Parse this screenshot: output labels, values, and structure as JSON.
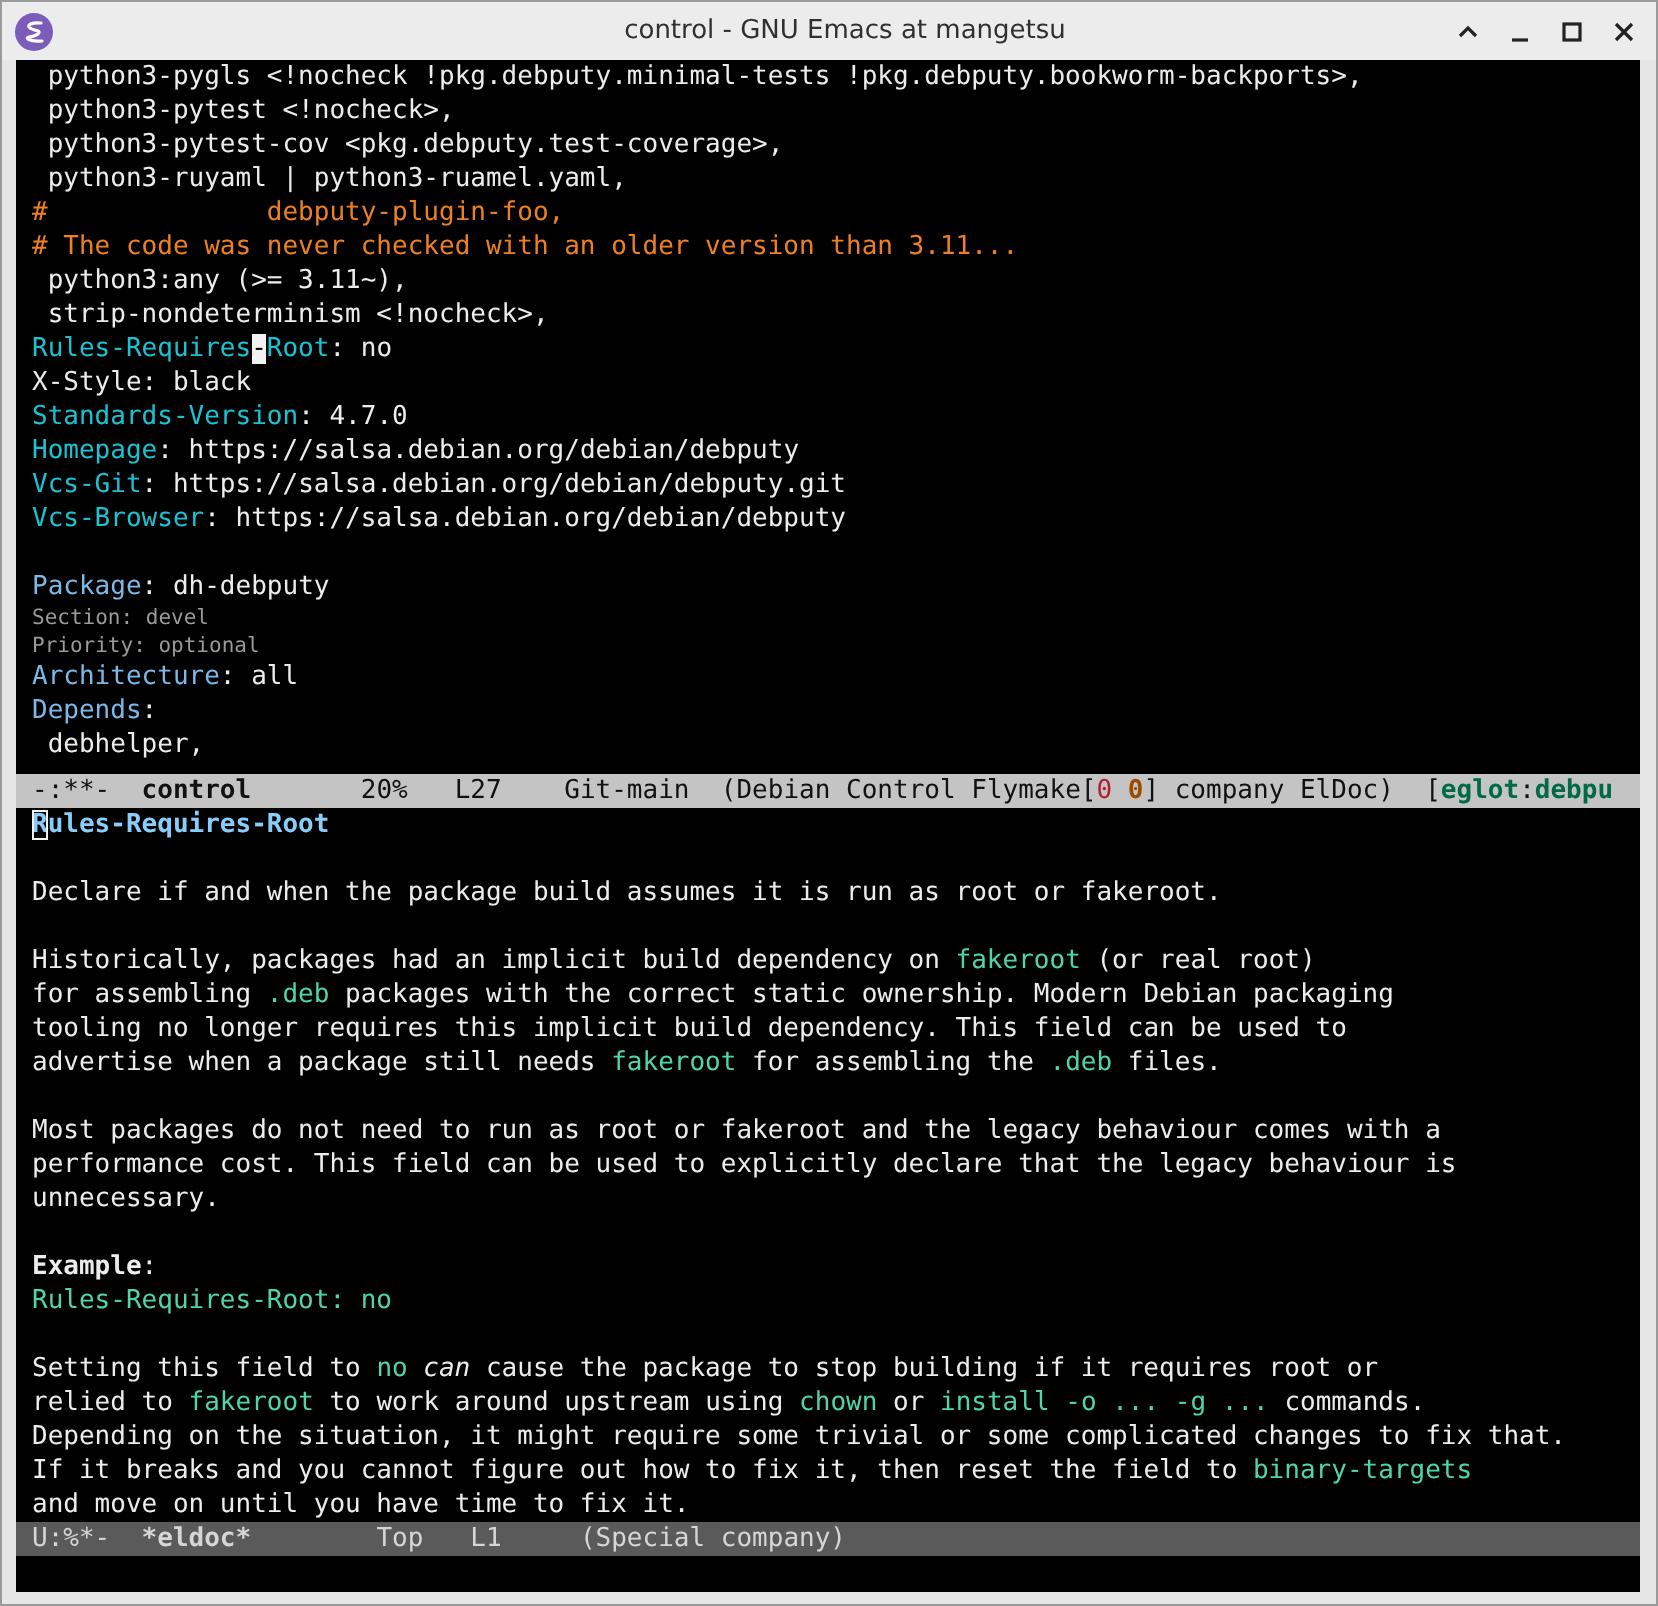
{
  "window": {
    "title": "control - GNU Emacs at mangetsu"
  },
  "top_pane": {
    "blocks": [
      {
        "lines": [
          {
            "segments": [
              {
                "kind": "plain",
                "text": " python3-pygls <!nocheck !pkg.debputy.minimal-tests !pkg.debputy.bookworm-backports>,"
              }
            ]
          },
          {
            "segments": [
              {
                "kind": "plain",
                "text": " python3-pytest <!nocheck>,"
              }
            ]
          },
          {
            "segments": [
              {
                "kind": "plain",
                "text": " python3-pytest-cov <pkg.debputy.test-coverage>,"
              }
            ]
          },
          {
            "segments": [
              {
                "kind": "plain",
                "text": " python3-ruyaml | python3-ruamel.yaml,"
              }
            ]
          },
          {
            "segments": [
              {
                "kind": "comment",
                "text": "#              debputy-plugin-foo,"
              }
            ]
          },
          {
            "segments": [
              {
                "kind": "comment",
                "text": "# The code was never checked with an older version than 3.11..."
              }
            ]
          },
          {
            "segments": [
              {
                "kind": "plain",
                "text": " python3:any (>= 3.11~),"
              }
            ]
          },
          {
            "segments": [
              {
                "kind": "plain",
                "text": " strip-nondeterminism <!nocheck>,"
              }
            ]
          },
          {
            "segments": [
              {
                "kind": "field",
                "text": "Rules-Requires"
              },
              {
                "kind": "cursor",
                "text": "-"
              },
              {
                "kind": "field",
                "text": "Root"
              },
              {
                "kind": "plain",
                "text": ": no"
              }
            ]
          },
          {
            "segments": [
              {
                "kind": "plain",
                "text": "X-Style: black"
              }
            ]
          },
          {
            "segments": [
              {
                "kind": "field",
                "text": "Standards-Version"
              },
              {
                "kind": "plain",
                "text": ": 4.7.0"
              }
            ]
          },
          {
            "segments": [
              {
                "kind": "field",
                "text": "Homepage"
              },
              {
                "kind": "plain",
                "text": ": https://salsa.debian.org/debian/debputy"
              }
            ]
          },
          {
            "segments": [
              {
                "kind": "field",
                "text": "Vcs-Git"
              },
              {
                "kind": "plain",
                "text": ": https://salsa.debian.org/debian/debputy.git"
              }
            ]
          },
          {
            "segments": [
              {
                "kind": "field",
                "text": "Vcs-Browser"
              },
              {
                "kind": "plain",
                "text": ": https://salsa.debian.org/debian/debputy"
              }
            ]
          }
        ]
      },
      {
        "lines": [
          {
            "segments": [
              {
                "kind": "field-alt",
                "text": "Package"
              },
              {
                "kind": "plain",
                "text": ": dh-debputy"
              }
            ]
          },
          {
            "small": true,
            "segments": [
              {
                "kind": "annotation",
                "text": "Section: devel"
              }
            ]
          },
          {
            "small": true,
            "segments": [
              {
                "kind": "annotation",
                "text": "Priority: optional"
              }
            ]
          },
          {
            "segments": [
              {
                "kind": "field-alt",
                "text": "Architecture"
              },
              {
                "kind": "plain",
                "text": ": all"
              }
            ]
          },
          {
            "segments": [
              {
                "kind": "field-alt",
                "text": "Depends"
              },
              {
                "kind": "plain",
                "text": ":"
              }
            ]
          },
          {
            "segments": [
              {
                "kind": "plain",
                "text": " debhelper,"
              }
            ]
          }
        ]
      }
    ]
  },
  "top_mode_line": {
    "active": true,
    "segments": [
      {
        "kind": "plain",
        "text": "-:**-  "
      },
      {
        "kind": "bold",
        "text": "control"
      },
      {
        "kind": "plain",
        "text": "       20%   L27    Git-main  (Debian Control Flymake["
      },
      {
        "kind": "error-count",
        "text": "0"
      },
      {
        "kind": "warning-count",
        "text": "0"
      },
      {
        "kind": "plain",
        "text": "] company ElDoc)  ["
      },
      {
        "kind": "eglot",
        "text": "eglot"
      },
      {
        "kind": "plain",
        "text": ":"
      },
      {
        "kind": "eglot",
        "text": "debpu"
      }
    ]
  },
  "bottom_pane": {
    "blocks": [
      {
        "lines": [
          {
            "segments": [
              {
                "kind": "box-cursor",
                "text": "R"
              },
              {
                "kind": "heading",
                "text": "ules-Requires-Root"
              }
            ]
          }
        ]
      },
      {
        "lines": [
          {
            "segments": [
              {
                "kind": "plain",
                "text": "Declare if and when the package build assumes it is run as root or fakeroot."
              }
            ]
          }
        ]
      },
      {
        "lines": [
          {
            "segments": [
              {
                "kind": "plain",
                "text": "Historically, packages had an implicit build dependency on "
              },
              {
                "kind": "code",
                "text": "fakeroot"
              },
              {
                "kind": "plain",
                "text": " (or real root)"
              }
            ]
          },
          {
            "segments": [
              {
                "kind": "plain",
                "text": "for assembling "
              },
              {
                "kind": "code",
                "text": ".deb"
              },
              {
                "kind": "plain",
                "text": " packages with the correct static ownership. Modern Debian packaging"
              }
            ]
          },
          {
            "segments": [
              {
                "kind": "plain",
                "text": "tooling no longer requires this implicit build dependency. This field can be used to"
              }
            ]
          },
          {
            "segments": [
              {
                "kind": "plain",
                "text": "advertise when a package still needs "
              },
              {
                "kind": "code",
                "text": "fakeroot"
              },
              {
                "kind": "plain",
                "text": " for assembling the "
              },
              {
                "kind": "code",
                "text": ".deb"
              },
              {
                "kind": "plain",
                "text": " files."
              }
            ]
          }
        ]
      },
      {
        "lines": [
          {
            "segments": [
              {
                "kind": "plain",
                "text": "Most packages do not need to run as root or fakeroot and the legacy behaviour comes with a"
              }
            ]
          },
          {
            "segments": [
              {
                "kind": "plain",
                "text": "performance cost. This field can be used to explicitly declare that the legacy behaviour is"
              }
            ]
          },
          {
            "segments": [
              {
                "kind": "plain",
                "text": "unnecessary."
              }
            ]
          }
        ]
      },
      {
        "lines": [
          {
            "segments": [
              {
                "kind": "bold",
                "text": "Example"
              },
              {
                "kind": "plain",
                "text": ":"
              }
            ]
          },
          {
            "segments": [
              {
                "kind": "code",
                "text": "Rules-Requires-Root: no"
              }
            ]
          }
        ]
      },
      {
        "lines": [
          {
            "segments": [
              {
                "kind": "plain",
                "text": "Setting this field to "
              },
              {
                "kind": "code",
                "text": "no"
              },
              {
                "kind": "emphasis",
                "text": "can"
              },
              {
                "kind": "plain",
                "text": " cause the package to stop building if it requires root or"
              }
            ]
          },
          {
            "segments": [
              {
                "kind": "plain",
                "text": "relied to "
              },
              {
                "kind": "code",
                "text": "fakeroot"
              },
              {
                "kind": "plain",
                "text": " to work around upstream using "
              },
              {
                "kind": "code",
                "text": "chown"
              },
              {
                "kind": "plain",
                "text": " or "
              },
              {
                "kind": "code",
                "text": "install -o ... -g ..."
              },
              {
                "kind": "plain",
                "text": " commands."
              }
            ]
          },
          {
            "segments": [
              {
                "kind": "plain",
                "text": "Depending on the situation, it might require some trivial or some complicated changes to fix that."
              }
            ]
          },
          {
            "segments": [
              {
                "kind": "plain",
                "text": "If it breaks and you cannot figure out how to fix it, then reset the field to "
              },
              {
                "kind": "code",
                "text": "binary-targets"
              }
            ]
          },
          {
            "segments": [
              {
                "kind": "plain",
                "text": "and move on until you have time to fix it."
              }
            ]
          }
        ]
      }
    ]
  },
  "bottom_mode_line": {
    "active": false,
    "segments": [
      {
        "kind": "plain",
        "text": "U:%*-  "
      },
      {
        "kind": "bold",
        "text": "*eldoc*"
      },
      {
        "kind": "plain",
        "text": "        Top   L1     (Special company)"
      }
    ]
  }
}
